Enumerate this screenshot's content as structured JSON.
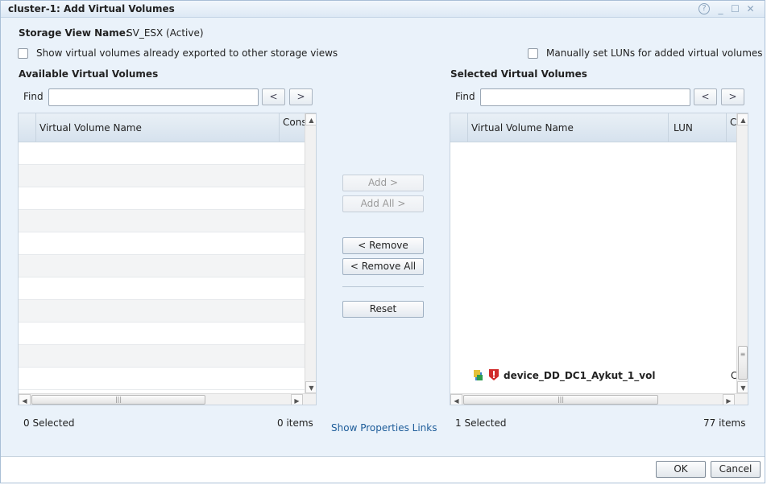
{
  "window": {
    "title": "cluster-1: Add Virtual Volumes",
    "controls": {
      "help": "?",
      "minimize": "_",
      "maximize": "☐",
      "close": "✕"
    }
  },
  "storage_view": {
    "label": "Storage View Name:",
    "value": "SV_ESX (Active)"
  },
  "options": {
    "show_exported": {
      "label": "Show virtual volumes already exported to other storage views",
      "checked": false
    },
    "manual_luns": {
      "label": "Manually set LUNs for added virtual volumes",
      "checked": false
    }
  },
  "available": {
    "title": "Available Virtual Volumes",
    "find_label": "Find",
    "find_value": "",
    "prev": "<",
    "next": ">",
    "columns": [
      "Virtual Volume Name",
      "Cons"
    ],
    "selected_count": "0 Selected",
    "item_count": "0 items"
  },
  "selected": {
    "title": "Selected Virtual Volumes",
    "find_label": "Find",
    "find_value": "",
    "prev": "<",
    "next": ">",
    "columns": [
      "Virtual Volume Name",
      "LUN",
      "C"
    ],
    "rows": [
      {
        "name": "device_DD_DC1_Aykut_1_vol",
        "lun": "",
        "c": "C"
      }
    ],
    "selected_count": "1 Selected",
    "item_count": "77 items"
  },
  "actions": {
    "add": "Add >",
    "add_all": "Add All >",
    "remove": "< Remove",
    "remove_all": "< Remove All",
    "reset": "Reset"
  },
  "links": {
    "show_properties": "Show Properties Links"
  },
  "footer": {
    "ok": "OK",
    "cancel": "Cancel"
  },
  "icons": {
    "volume": "volume-icon",
    "warning": "warning-icon"
  },
  "colors": {
    "accent": "#1d5c99",
    "dialog_bg": "#eaf2fa",
    "warning": "#d12b2b"
  }
}
